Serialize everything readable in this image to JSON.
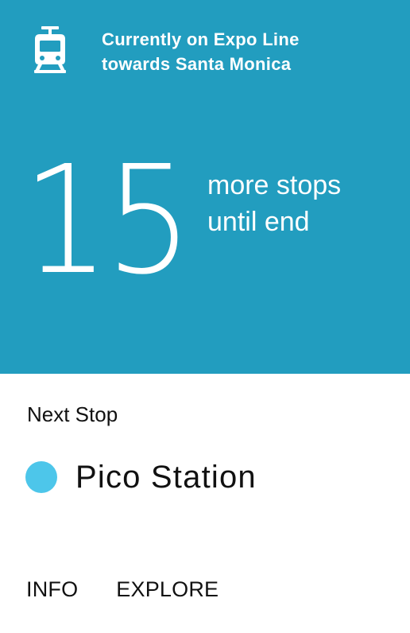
{
  "header": {
    "icon": "train-icon",
    "route_line1": "Currently on Expo Line",
    "route_line2": "towards Santa Monica",
    "background_color": "#229dbf"
  },
  "stops": {
    "count": "15",
    "caption_line1": "more stops",
    "caption_line2": "until end"
  },
  "next_stop": {
    "label": "Next Stop",
    "name": "Pico Station",
    "dot_color": "#4dc6ea"
  },
  "actions": {
    "info_label": "INFO",
    "explore_label": "EXPLORE"
  }
}
